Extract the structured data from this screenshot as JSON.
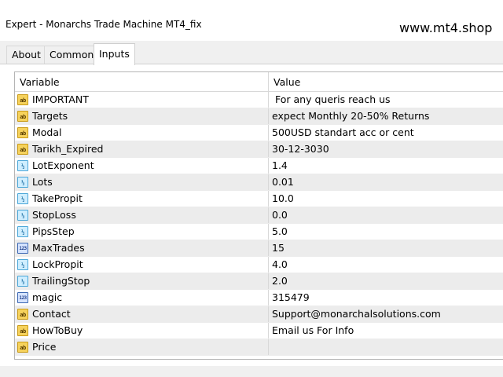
{
  "window": {
    "title": "Expert - Monarchs Trade Machine MT4_fix",
    "watermark": "www.mt4.shop"
  },
  "tabs": [
    {
      "label": "About",
      "active": false
    },
    {
      "label": "Common",
      "active": false
    },
    {
      "label": "Inputs",
      "active": true
    }
  ],
  "table": {
    "columns": [
      "Variable",
      "Value"
    ],
    "rows": [
      {
        "type": "string",
        "icon": "ab",
        "variable": "IMPORTANT",
        "value": "For any queris reach us"
      },
      {
        "type": "string",
        "icon": "ab",
        "variable": "Targets",
        "value": "expect Monthly 20-50% Returns"
      },
      {
        "type": "string",
        "icon": "ab",
        "variable": "Modal",
        "value": "500USD standart acc or cent"
      },
      {
        "type": "string",
        "icon": "ab",
        "variable": "Tarikh_Expired",
        "value": "30-12-3030"
      },
      {
        "type": "double",
        "icon": "½",
        "variable": "LotExponent",
        "value": "1.4"
      },
      {
        "type": "double",
        "icon": "½",
        "variable": "Lots",
        "value": "0.01"
      },
      {
        "type": "double",
        "icon": "½",
        "variable": "TakePropit",
        "value": "10.0"
      },
      {
        "type": "double",
        "icon": "½",
        "variable": "StopLoss",
        "value": "0.0"
      },
      {
        "type": "double",
        "icon": "½",
        "variable": "PipsStep",
        "value": "5.0"
      },
      {
        "type": "integer",
        "icon": "123",
        "variable": "MaxTrades",
        "value": "15"
      },
      {
        "type": "double",
        "icon": "½",
        "variable": "LockPropit",
        "value": "4.0"
      },
      {
        "type": "double",
        "icon": "½",
        "variable": "TrailingStop",
        "value": "2.0"
      },
      {
        "type": "integer",
        "icon": "123",
        "variable": "magic",
        "value": "315479"
      },
      {
        "type": "string",
        "icon": "ab",
        "variable": "Contact",
        "value": "Support@monarchalsolutions.com"
      },
      {
        "type": "string",
        "icon": "ab",
        "variable": "HowToBuy",
        "value": "Email us For Info"
      },
      {
        "type": "string",
        "icon": "ab",
        "variable": "Price",
        "value": ""
      }
    ]
  }
}
